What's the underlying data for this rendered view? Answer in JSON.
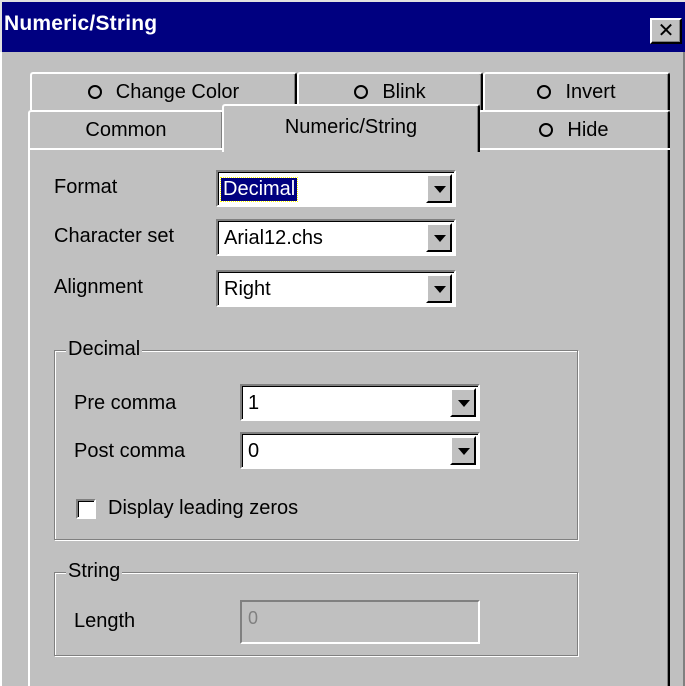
{
  "window": {
    "title": "Numeric/String",
    "close_symbol": "✕"
  },
  "tabs": {
    "row_back": [
      {
        "label": "Change Color"
      },
      {
        "label": "Blink"
      },
      {
        "label": "Invert"
      }
    ],
    "row_front": [
      {
        "label": "Common"
      },
      {
        "label": "Numeric/String",
        "active": true
      },
      {
        "label": "Hide"
      }
    ]
  },
  "form": {
    "format": {
      "label": "Format",
      "value": "Decimal"
    },
    "charset": {
      "label": "Character set",
      "value": "Arial12.chs"
    },
    "alignment": {
      "label": "Alignment",
      "value": "Right"
    }
  },
  "decimal_group": {
    "title": "Decimal",
    "pre_comma": {
      "label": "Pre comma",
      "value": "1"
    },
    "post_comma": {
      "label": "Post comma",
      "value": "0"
    },
    "leading_zeros": {
      "label": "Display leading zeros",
      "checked": false
    }
  },
  "string_group": {
    "title": "String",
    "length": {
      "label": "Length",
      "value": "0"
    }
  }
}
